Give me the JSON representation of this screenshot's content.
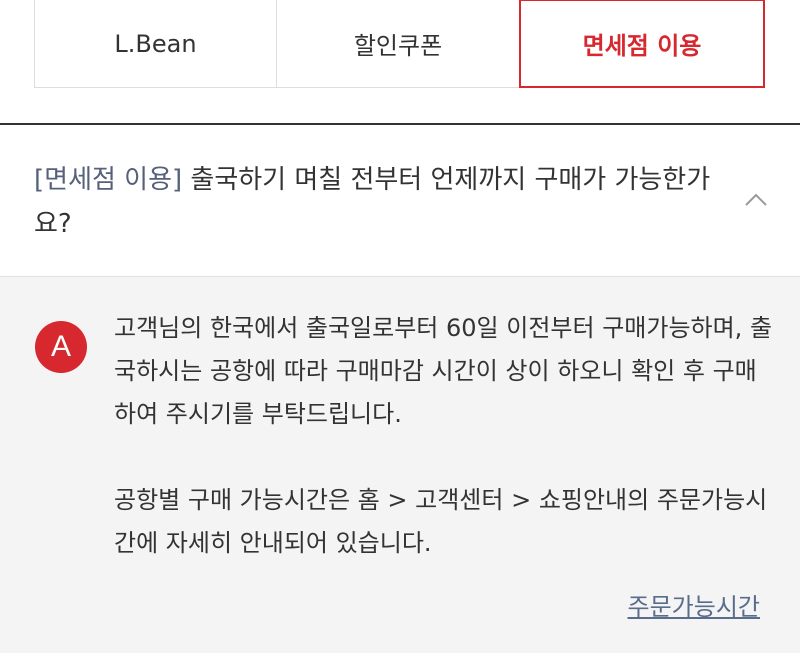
{
  "tabs": [
    {
      "label": "L.Bean",
      "active": false
    },
    {
      "label": "할인쿠폰",
      "active": false
    },
    {
      "label": "면세점 이용",
      "active": true
    }
  ],
  "question": {
    "tag": "[면세점 이용]",
    "text": " 출국하기 며칠 전부터 언제까지 구매가 가능한가요?",
    "toggle_icon": "chevron-up-icon"
  },
  "answer": {
    "badge": "A",
    "paragraph1": "고객님의 한국에서 출국일로부터 60일 이전부터 구매가능하며, 출국하시는 공항에 따라 구매마감 시간이 상이 하오니 확인 후 구매하여 주시기를 부탁드립니다.",
    "paragraph2": "공항별 구매 가능시간은 홈 > 고객센터 > 쇼핑안내의 주문가능시간에 자세히 안내되어 있습니다.",
    "link_label": "주문가능시간"
  },
  "colors": {
    "accent": "#d7282f",
    "tag": "#56607a",
    "link": "#5a6c8c",
    "answer_bg": "#f4f4f4"
  }
}
